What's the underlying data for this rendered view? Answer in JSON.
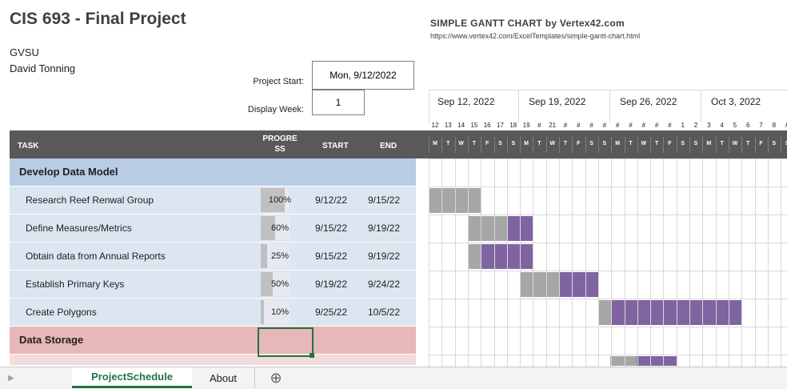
{
  "header": {
    "title": "CIS 693 - Final Project",
    "org": "GVSU",
    "author": "David Tonning",
    "gantt_title": "SIMPLE GANTT CHART by Vertex42.com",
    "gantt_url": "https://www.vertex42.com/ExcelTemplates/simple-gantt-chart.html"
  },
  "settings": {
    "project_start_label": "Project Start:",
    "project_start_value": "Mon, 9/12/2022",
    "display_week_label": "Display Week:",
    "display_week_value": "1"
  },
  "timeline": {
    "weeks": [
      "Sep 12, 2022",
      "Sep 19, 2022",
      "Sep 26, 2022",
      "Oct 3, 2022"
    ],
    "day_numbers": [
      "12",
      "13",
      "14",
      "15",
      "16",
      "17",
      "18",
      "19",
      "#",
      "21",
      "#",
      "#",
      "#",
      "#",
      "#",
      "#",
      "#",
      "#",
      "#",
      "1",
      "2",
      "3",
      "4",
      "5",
      "6",
      "7",
      "8",
      "#"
    ],
    "day_letters": [
      "M",
      "T",
      "W",
      "T",
      "F",
      "S",
      "S",
      "M",
      "T",
      "W",
      "T",
      "F",
      "S",
      "S",
      "M",
      "T",
      "W",
      "T",
      "F",
      "S",
      "S",
      "M",
      "T",
      "W",
      "T",
      "F",
      "S",
      "S"
    ]
  },
  "columns": {
    "task": "TASK",
    "progress": "PROGRESS",
    "start": "START",
    "end": "END"
  },
  "phases": [
    {
      "name": "Develop Data Model",
      "color": "#b8cce4",
      "row_color": "#dce6f1",
      "tasks": [
        {
          "name": "Research Reef Renwal Group",
          "progress": "100%",
          "progress_value": 1.0,
          "start": "9/12/22",
          "end": "9/15/22"
        },
        {
          "name": "Define Measures/Metrics",
          "progress": "60%",
          "progress_value": 0.6,
          "start": "9/15/22",
          "end": "9/19/22"
        },
        {
          "name": "Obtain data from Annual Reports",
          "progress": "25%",
          "progress_value": 0.25,
          "start": "9/15/22",
          "end": "9/19/22"
        },
        {
          "name": "Establish Primary Keys",
          "progress": "50%",
          "progress_value": 0.5,
          "start": "9/19/22",
          "end": "9/24/22"
        },
        {
          "name": "Create Polygons",
          "progress": "10%",
          "progress_value": 0.1,
          "start": "9/25/22",
          "end": "10/5/22"
        }
      ]
    },
    {
      "name": "Data Storage",
      "color": "#e6b8b7",
      "row_color": "#f2dcdb",
      "tasks": []
    }
  ],
  "colors": {
    "header_bg": "#595959",
    "bar_done": "#a6a6a6",
    "bar_todo": "#8064a2",
    "excel_green": "#217346"
  },
  "sheet_tabs": {
    "active": "ProjectSchedule",
    "other": "About",
    "add_icon": "plus-circle-icon",
    "nav_icon": "caret-left-icon"
  }
}
